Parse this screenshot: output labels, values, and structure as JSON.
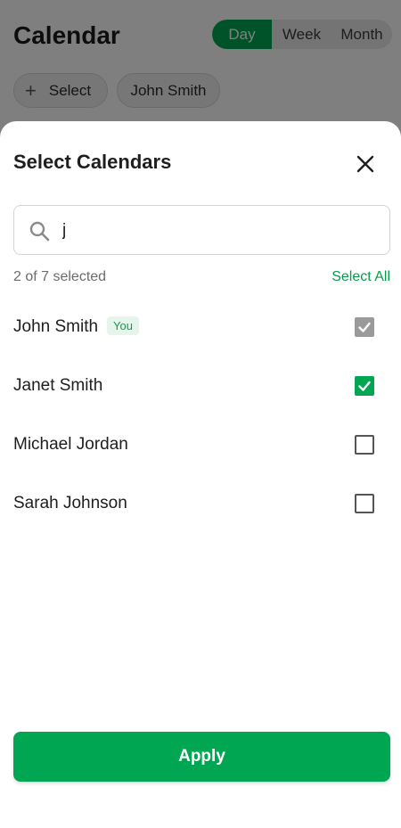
{
  "app": {
    "title": "Calendar",
    "view_modes": [
      {
        "label": "Day",
        "active": true
      },
      {
        "label": "Week",
        "active": false
      },
      {
        "label": "Month",
        "active": false
      }
    ],
    "chips": {
      "select_label": "Select",
      "user_label": "John Smith"
    }
  },
  "sheet": {
    "title": "Select Calendars",
    "search": {
      "value": "j",
      "icon": "search-icon"
    },
    "count_text": "2 of 7 selected",
    "select_all_label": "Select All",
    "items": [
      {
        "name": "John Smith",
        "badge": "You",
        "checked": true,
        "disabled": true
      },
      {
        "name": "Janet Smith",
        "badge": "",
        "checked": true,
        "disabled": false
      },
      {
        "name": "Michael Jordan",
        "badge": "",
        "checked": false,
        "disabled": false
      },
      {
        "name": "Sarah Johnson",
        "badge": "",
        "checked": false,
        "disabled": false
      }
    ],
    "apply_label": "Apply"
  },
  "colors": {
    "accent": "#00a651",
    "badge_bg": "#e6f5ec",
    "disabled_check": "#9a9a9a"
  }
}
